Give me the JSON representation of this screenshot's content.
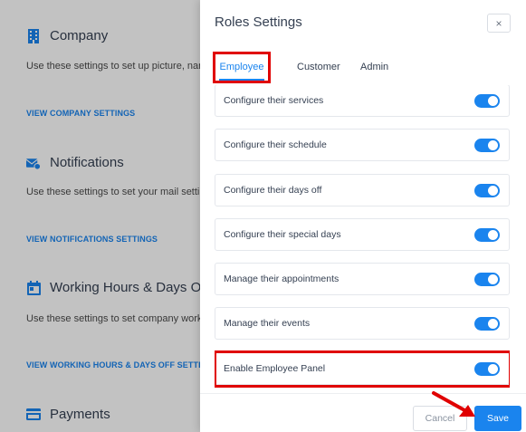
{
  "background": {
    "sections": [
      {
        "title": "Company",
        "icon": "building-icon",
        "desc": "Use these settings to set up picture, name, a",
        "link": "VIEW COMPANY SETTINGS"
      },
      {
        "title": "Notifications",
        "icon": "mail-icon",
        "desc": "Use these settings to set your mail settings w",
        "link": "VIEW NOTIFICATIONS SETTINGS"
      },
      {
        "title": "Working Hours & Days Off",
        "icon": "calendar-icon",
        "desc": "Use these settings to set company working h",
        "link": "VIEW WORKING HOURS & DAYS OFF SETTINGS"
      },
      {
        "title": "Payments",
        "icon": "credit-card-icon"
      }
    ]
  },
  "dialog": {
    "title": "Roles Settings",
    "close_label": "×",
    "tabs": [
      "Employee",
      "Customer",
      "Admin"
    ],
    "active_tab": "Employee",
    "permissions": [
      {
        "label": "Configure their services",
        "enabled": true
      },
      {
        "label": "Configure their schedule",
        "enabled": true
      },
      {
        "label": "Configure their days off",
        "enabled": true
      },
      {
        "label": "Configure their special days",
        "enabled": true
      },
      {
        "label": "Manage their appointments",
        "enabled": true
      },
      {
        "label": "Manage their events",
        "enabled": true
      },
      {
        "label": "Enable Employee Panel",
        "enabled": true
      }
    ],
    "cancel_label": "Cancel",
    "save_label": "Save"
  },
  "colors": {
    "accent": "#1a84ee",
    "highlight": "#e00000"
  }
}
